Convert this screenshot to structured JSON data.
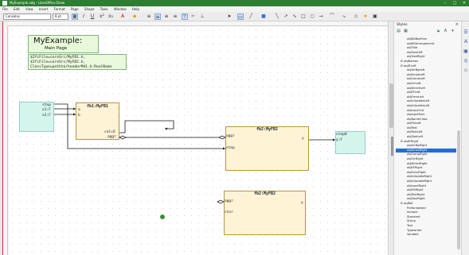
{
  "window": {
    "title": "MyExample.odg - LibreOffice Draw",
    "controls": [
      "–",
      "□",
      "✕"
    ]
  },
  "menu": [
    "File",
    "Edit",
    "View",
    "Insert",
    "Format",
    "Page",
    "Shape",
    "Tools",
    "Window",
    "Help"
  ],
  "toolbar": {
    "font_name": "Consolas",
    "font_size": "8 pt",
    "bold": "B",
    "italic": "I",
    "underline": "U"
  },
  "canvas": {
    "title_main": "MyExample:",
    "title_sub": "Main Page",
    "code_lines": "$IfcFile=coreSrc/MyFB1.h,\n$IfcFile=coreSrc/MyFB2.h,\nClassType=pathto/headerMd1.h:RealName",
    "left_inputs": {
      "line1": "step",
      "line2": "x1:F",
      "line3": "x2:F"
    },
    "fb1": {
      "title": "fb1:MyFB1",
      "pin_a": "a",
      "pin_b": "b",
      "pin_calc": "calcO",
      "pin_aggr": "aggr"
    },
    "fb2a": {
      "title": "fb2:MyFB2",
      "pin_aggr": "aggr",
      "pin_step": "step",
      "pin_y": "y"
    },
    "fb2b": {
      "title": "fb2:MyFB2",
      "pin_aggr": "aggr",
      "pin_ctor": "ctor",
      "pin_y": "y"
    },
    "right_outputs": {
      "line1": "step0",
      "line2": "y:F"
    }
  },
  "styles": {
    "title": "Styles",
    "items": [
      "objBGBoxFree",
      "objBGArrangement",
      "objTitle",
      "objSizeLeft",
      "objSizeRight",
      "⊟ objNames",
      "⊟ objFrLeft",
      "objArrBgLeft",
      "objArrowLeft",
      "objCompLeft",
      "objCtrLeft",
      "objDirectLeft",
      "objEFLeft",
      "objErrorLeft",
      "objIcUpdateLeft",
      "objIcUpdateLeft",
      "objInputOut",
      "objInputText",
      "objNameClass",
      "objPinLeft",
      "objText",
      "objTextLeft",
      "objZoolLeft",
      "⊟ objFrRight",
      "objArrBgRight",
      "objArrowRight",
      "objCompRight",
      "objCtrRight",
      "objDirectRight",
      "objEFRight",
      "objErrorRight",
      "objIcUpdateRight",
      "objIcUpdateRight",
      "objInputRight",
      "objPinRight",
      "objTextRight",
      "objZoolRight",
      "⊟ objRef",
      "Preformatted",
      "Sample",
      "Standard",
      "String",
      "Text",
      "Typewriter",
      "Variable"
    ],
    "selected_index": 25
  }
}
